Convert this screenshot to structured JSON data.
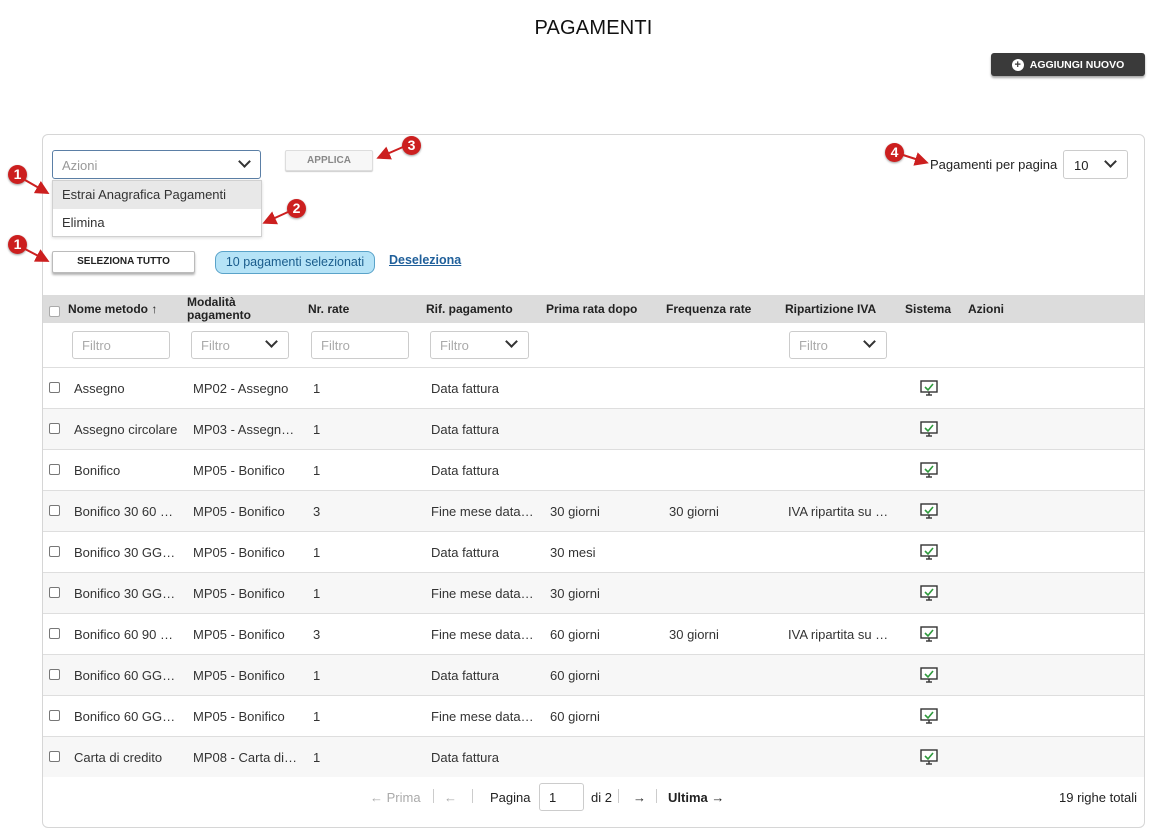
{
  "title": "PAGAMENTI",
  "add_button": {
    "label": "AGGIUNGI NUOVO"
  },
  "bulk": {
    "placeholder": "Azioni",
    "options": [
      "Estrai Anagrafica Pagamenti",
      "Elimina"
    ],
    "apply_label": "APPLICA",
    "select_all_label": "SELEZIONA TUTTO",
    "selected_badge": "10 pagamenti selezionati",
    "deselect_label": "Deseleziona"
  },
  "per_page": {
    "label": "Pagamenti per pagina",
    "value": "10"
  },
  "markers": [
    "1",
    "2",
    "3",
    "4",
    "1"
  ],
  "columns": {
    "name": "Nome metodo",
    "sort_indicator": "↑",
    "mode_line1": "Modalità",
    "mode_line2": "pagamento",
    "rates": "Nr. rate",
    "ref": "Rif. pagamento",
    "first": "Prima rata dopo",
    "freq": "Frequenza rate",
    "vat": "Ripartizione IVA",
    "system": "Sistema",
    "actions": "Azioni"
  },
  "filters": {
    "placeholder": "Filtro"
  },
  "rows": [
    {
      "name": "Assegno",
      "mode": "MP02 - Assegno",
      "rates": "1",
      "ref": "Data fattura",
      "first": "",
      "freq": "",
      "vat": ""
    },
    {
      "name": "Assegno circolare",
      "mode": "MP03 - Assegn…",
      "rates": "1",
      "ref": "Data fattura",
      "first": "",
      "freq": "",
      "vat": ""
    },
    {
      "name": "Bonifico",
      "mode": "MP05 - Bonifico",
      "rates": "1",
      "ref": "Data fattura",
      "first": "",
      "freq": "",
      "vat": ""
    },
    {
      "name": "Bonifico 30 60 …",
      "mode": "MP05 - Bonifico",
      "rates": "3",
      "ref": "Fine mese data…",
      "first": "30 giorni",
      "freq": "30 giorni",
      "vat": "IVA ripartita su …"
    },
    {
      "name": "Bonifico 30 GG…",
      "mode": "MP05 - Bonifico",
      "rates": "1",
      "ref": "Data fattura",
      "first": "30 mesi",
      "freq": "",
      "vat": ""
    },
    {
      "name": "Bonifico 30 GG…",
      "mode": "MP05 - Bonifico",
      "rates": "1",
      "ref": "Fine mese data…",
      "first": "30 giorni",
      "freq": "",
      "vat": ""
    },
    {
      "name": "Bonifico 60 90 …",
      "mode": "MP05 - Bonifico",
      "rates": "3",
      "ref": "Fine mese data…",
      "first": "60 giorni",
      "freq": "30 giorni",
      "vat": "IVA ripartita su …"
    },
    {
      "name": "Bonifico 60 GG…",
      "mode": "MP05 - Bonifico",
      "rates": "1",
      "ref": "Data fattura",
      "first": "60 giorni",
      "freq": "",
      "vat": ""
    },
    {
      "name": "Bonifico 60 GG…",
      "mode": "MP05 - Bonifico",
      "rates": "1",
      "ref": "Fine mese data…",
      "first": "60 giorni",
      "freq": "",
      "vat": ""
    },
    {
      "name": "Carta di credito",
      "mode": "MP08 - Carta di…",
      "rates": "1",
      "ref": "Data fattura",
      "first": "",
      "freq": "",
      "vat": ""
    }
  ],
  "pagination": {
    "first": "← Prima",
    "prev": "←",
    "page_label": "Pagina",
    "page_value": "1",
    "of_label": "di 2",
    "next": "→",
    "last": "Ultima →",
    "total": "19 righe totali"
  }
}
